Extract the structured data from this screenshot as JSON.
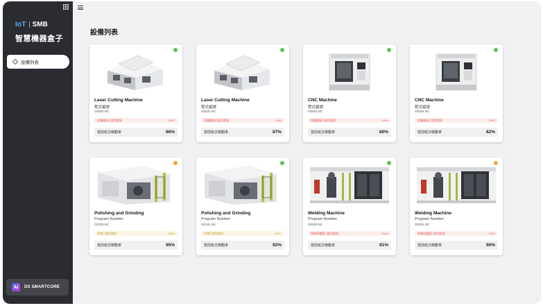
{
  "brand": {
    "iot": "IoT",
    "smb": "SMB",
    "subtitle": "智慧機器盒子"
  },
  "sidebar": {
    "items": [
      {
        "label": "設備列表",
        "icon": "diamond-icon"
      }
    ],
    "footer": {
      "logo": "AI",
      "label": "DS SMARTCORE"
    }
  },
  "page": {
    "title": "設備列表"
  },
  "colors": {
    "status_green": "#5fbf5a",
    "status_orange": "#f0a63a",
    "sidebar_bg": "#2b2c31"
  },
  "machines": [
    {
      "name": "Laser Cutting Machine",
      "program": "程式編號",
      "file": "O0002.NC",
      "alert": "保護鏡過已使用超過",
      "alert_value": "100H",
      "alert_type": "red",
      "rate_label": "當前班次稼動率",
      "rate": "86%",
      "status": "green",
      "image": "laser"
    },
    {
      "name": "Laser Cutting Machine",
      "program": "程式編號",
      "file": "O0031.NC",
      "alert": "保護鏡過已使用超過",
      "alert_value": "100H",
      "alert_type": "red",
      "rate_label": "當前班次稼動率",
      "rate": "87%",
      "status": "green",
      "image": "laser"
    },
    {
      "name": "CNC Machine",
      "program": "程式編號",
      "file": "O0052.NC",
      "alert": "保護鏡過已使用超過",
      "alert_value": "100H",
      "alert_type": "red",
      "rate_label": "當前班次稼動率",
      "rate": "80%",
      "status": "green",
      "image": "cnc"
    },
    {
      "name": "CNC Machine",
      "program": "程式編號",
      "file": "O0053.NC",
      "alert": "保護鏡過已使用超過",
      "alert_value": "100H",
      "alert_type": "red",
      "rate_label": "當前班次稼動率",
      "rate": "82%",
      "status": "green",
      "image": "cnc"
    },
    {
      "name": "Polishing and Grinding",
      "program": "Program Number",
      "file": "O0100.NC",
      "alert": "砂帶已使用超過",
      "alert_value": "500H",
      "alert_type": "yellow",
      "rate_label": "當前班次稼動率",
      "rate": "95%",
      "status": "orange",
      "image": "polish"
    },
    {
      "name": "Polishing and Grinding",
      "program": "Program Number",
      "file": "O0101.NC",
      "alert": "砂帶已使用超過",
      "alert_value": "500H",
      "alert_type": "yellow",
      "rate_label": "當前班次稼動率",
      "rate": "92%",
      "status": "green",
      "image": "polish"
    },
    {
      "name": "Welding Machine",
      "program": "Program Number",
      "file": "O0200.NC",
      "alert": "焊槍保護套已使用超過",
      "alert_value": "100H",
      "alert_type": "red",
      "rate_label": "當前班次稼動率",
      "rate": "91%",
      "status": "green",
      "image": "weld"
    },
    {
      "name": "Welding Machine",
      "program": "Program Number",
      "file": "O0201.NC",
      "alert": "焊槍保護套已使用超過",
      "alert_value": "100H",
      "alert_type": "red",
      "rate_label": "當前班次稼動率",
      "rate": "90%",
      "status": "orange",
      "image": "weld"
    }
  ]
}
